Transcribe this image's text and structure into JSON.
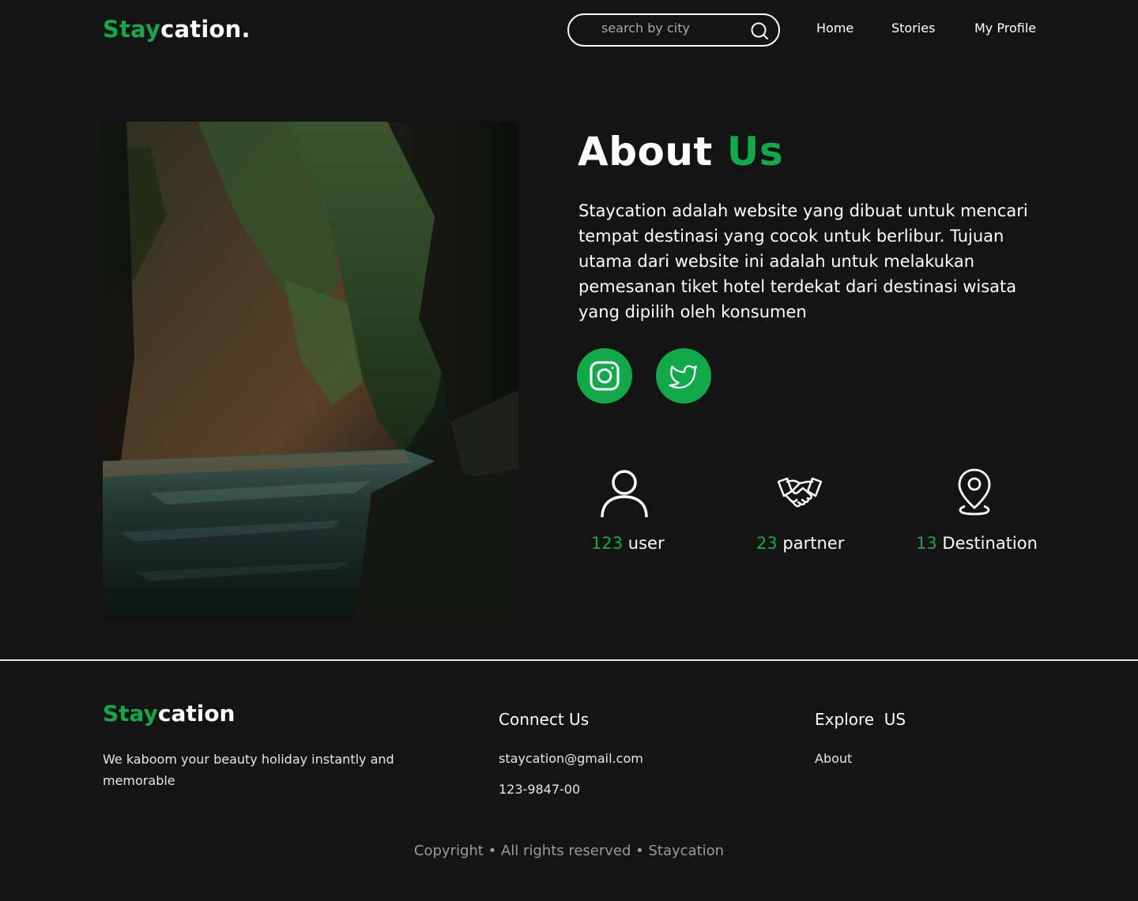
{
  "header": {
    "logo": {
      "accent": "Stay",
      "rest": "cation."
    },
    "search": {
      "placeholder": "search by city",
      "value": ""
    },
    "nav": [
      {
        "label": "Home"
      },
      {
        "label": "Stories"
      },
      {
        "label": "My Profile"
      }
    ]
  },
  "about": {
    "title_main": "About",
    "title_accent": "Us",
    "description": "Staycation adalah website yang dibuat untuk mencari tempat destinasi yang cocok untuk berlibur. Tujuan utama dari website ini adalah untuk melakukan pemesanan tiket hotel terdekat dari destinasi wisata yang dipilih oleh konsumen",
    "social": [
      {
        "icon": "instagram-icon"
      },
      {
        "icon": "twitter-icon"
      }
    ],
    "stats": [
      {
        "icon": "user-icon",
        "value": "123",
        "label": "user"
      },
      {
        "icon": "handshake-icon",
        "value": "23",
        "label": "partner"
      },
      {
        "icon": "location-pin-icon",
        "value": "13",
        "label": "Destination"
      }
    ]
  },
  "footer": {
    "logo": {
      "accent": "Stay",
      "rest": "cation"
    },
    "description": "We kaboom your beauty holiday instantly and memorable",
    "connect": {
      "heading": "Connect Us",
      "email": "staycation@gmail.com",
      "phone": "123-9847-00"
    },
    "explore": {
      "heading": "Explore  US",
      "links": [
        {
          "label": "About"
        }
      ]
    },
    "copyright": "Copyright • All rights reserved • Staycation"
  },
  "colors": {
    "accent": "#12a94a",
    "background": "#141414",
    "text": "#ffffff"
  }
}
